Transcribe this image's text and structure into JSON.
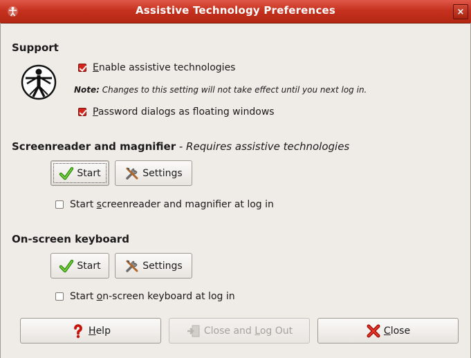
{
  "window": {
    "title": "Assistive Technology Preferences",
    "close_glyph": "×"
  },
  "support": {
    "heading": "Support",
    "enable_assistive": {
      "mnemonic": "E",
      "rest": "nable assistive technologies",
      "checked": true
    },
    "note_label": "Note:",
    "note_text": " Changes to this setting will not take effect until you next log in.",
    "password_dialogs": {
      "mnemonic": "P",
      "rest": "assword dialogs as floating windows",
      "checked": true
    }
  },
  "screenreader": {
    "heading": "Screenreader and magnifier",
    "heading_note": " - Requires assistive technologies",
    "start_label": "Start",
    "settings_label": "Settings",
    "autostart": {
      "prefix": "Start ",
      "mnemonic": "s",
      "rest": "creenreader and magnifier at log in",
      "checked": false
    }
  },
  "keyboard": {
    "heading": "On-screen keyboard",
    "start_label": "Start",
    "settings_label": "Settings",
    "autostart": {
      "prefix": "Start ",
      "mnemonic": "o",
      "rest": "n-screen keyboard at log in",
      "checked": false
    }
  },
  "footer": {
    "help": {
      "mnemonic": "H",
      "rest": "elp"
    },
    "close_logout": {
      "prefix": "Close and ",
      "mnemonic": "L",
      "rest": "og Out",
      "enabled": false
    },
    "close": {
      "mnemonic": "C",
      "rest": "lose"
    }
  },
  "icons": {
    "app": "accessibility-icon",
    "start": "green-check-icon",
    "settings": "tools-icon",
    "help": "question-mark-icon",
    "logout": "logout-icon",
    "close": "red-x-icon"
  },
  "colors": {
    "titlebar": "#c6321f",
    "checkbox_checked": "#d2251d",
    "window_bg": "#efebe7"
  }
}
